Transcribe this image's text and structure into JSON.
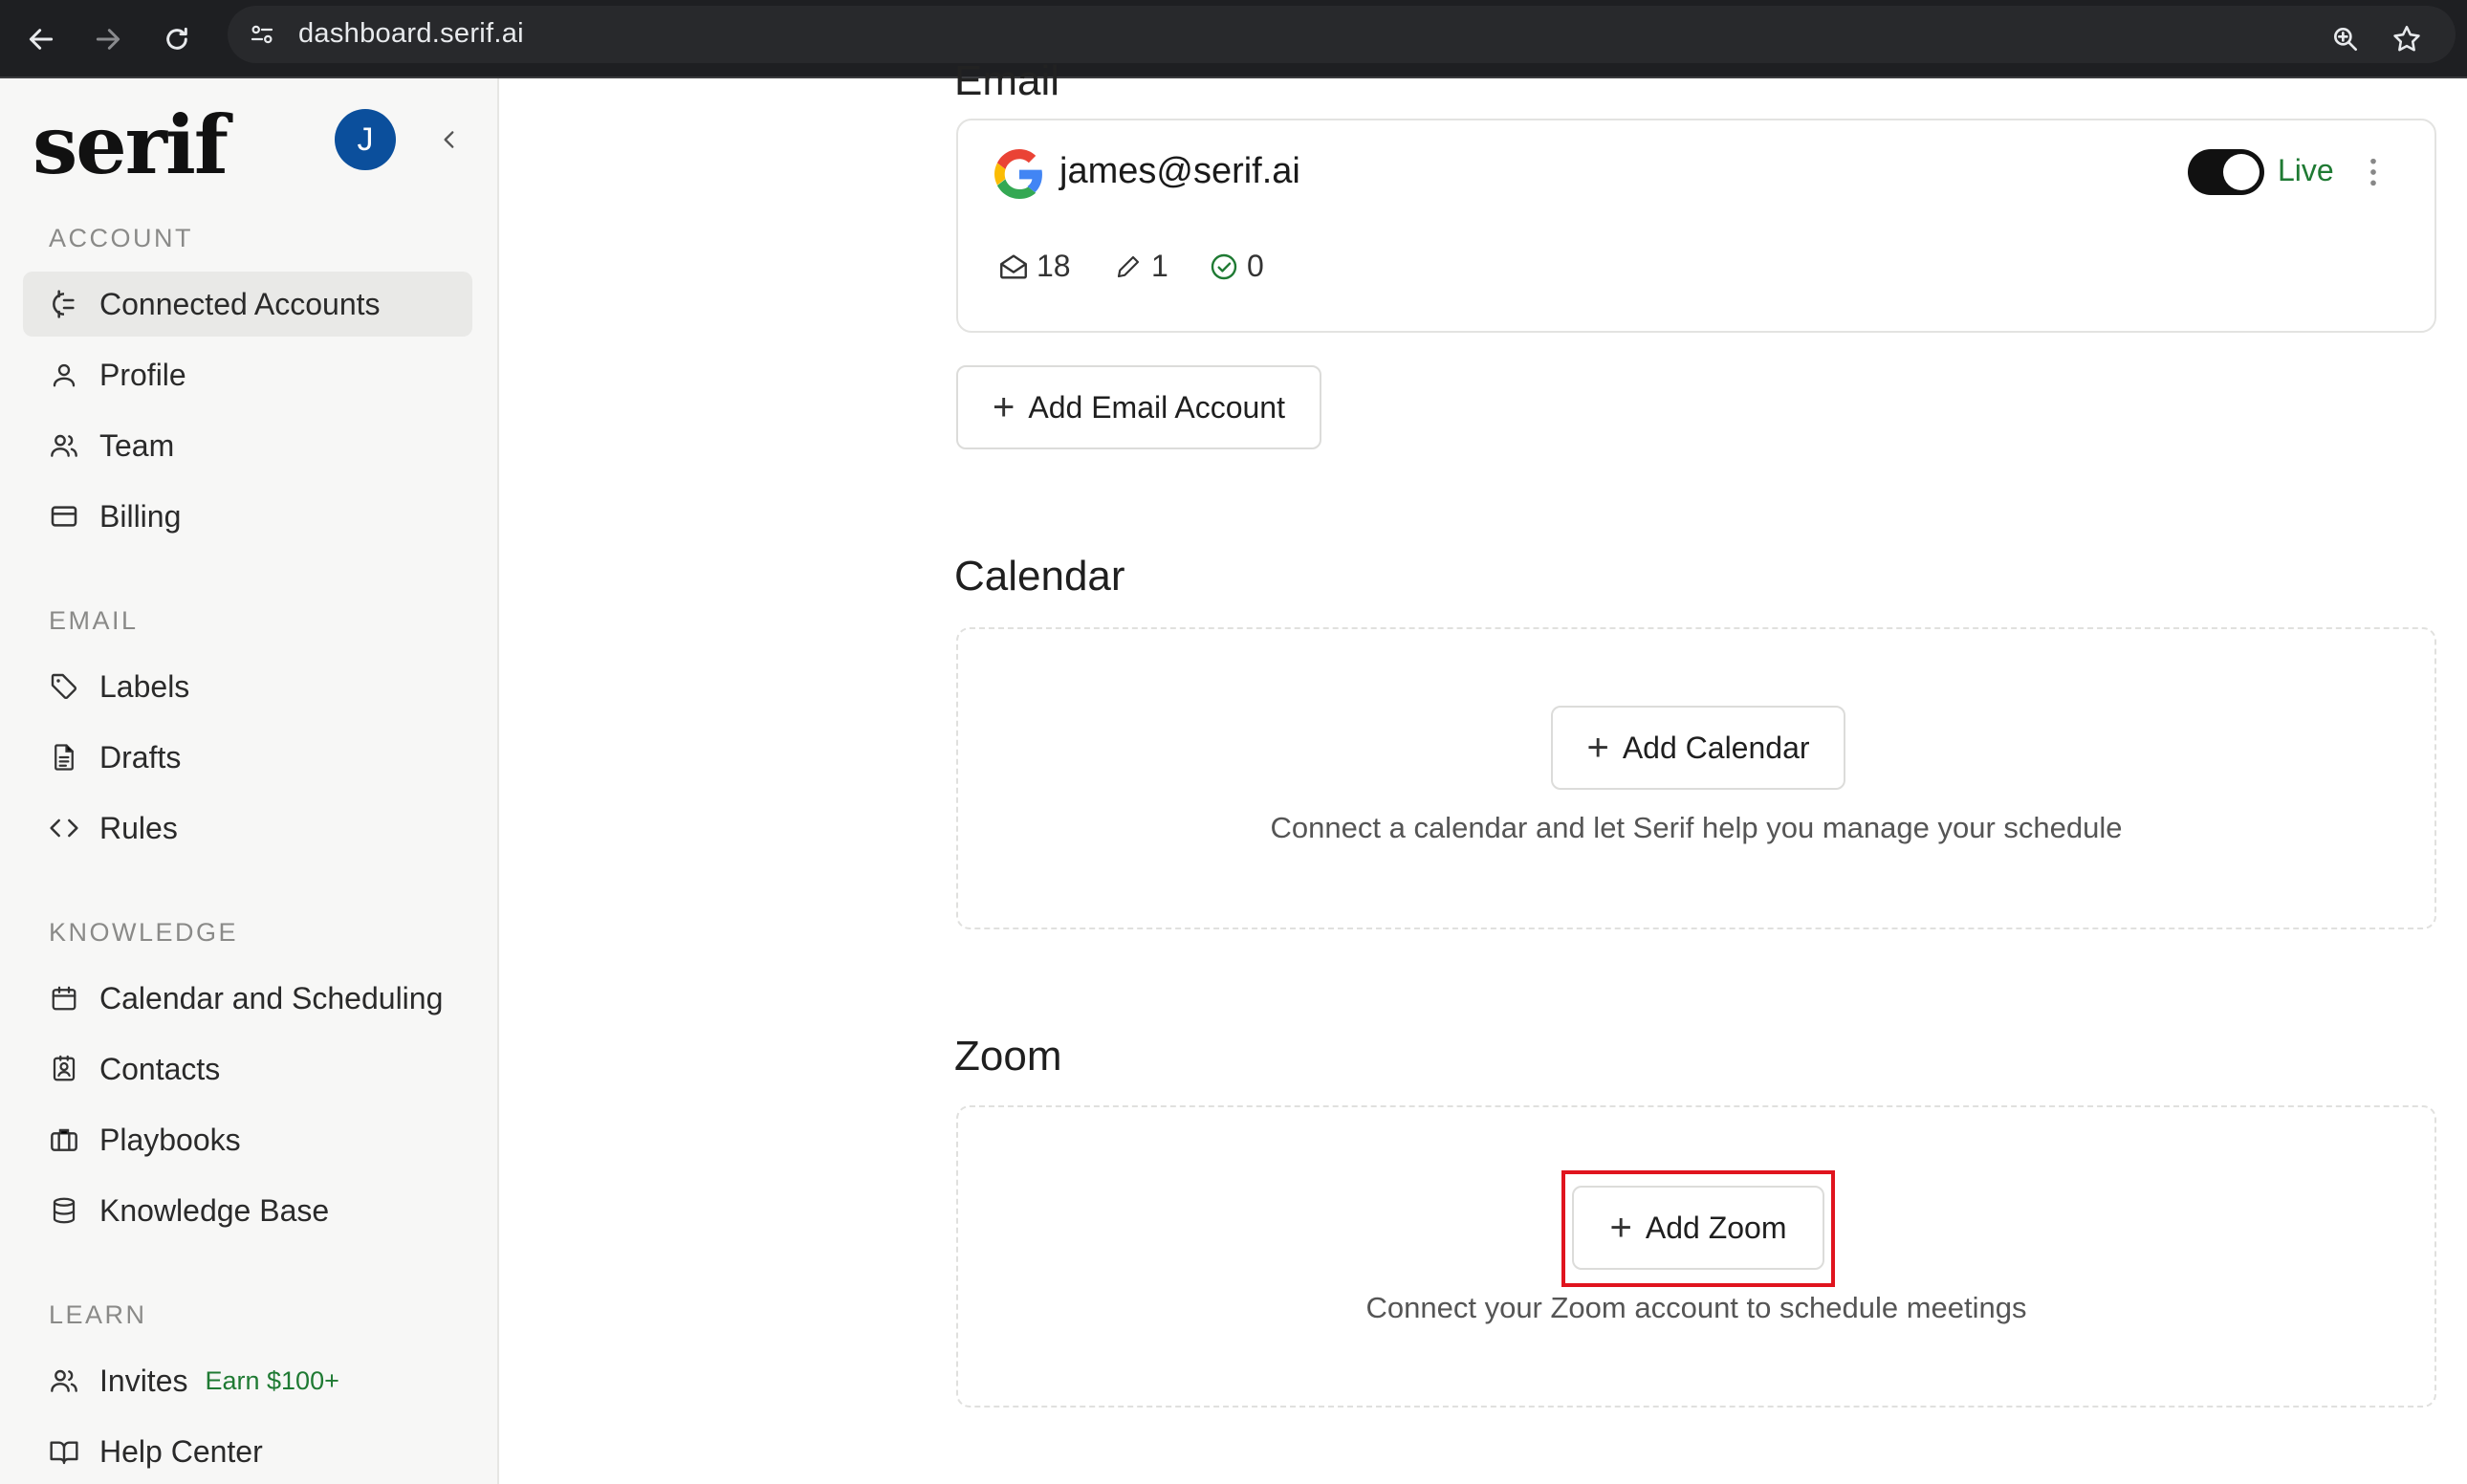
{
  "browser": {
    "url": "dashboard.serif.ai"
  },
  "sidebar": {
    "logo": "serif",
    "avatar_initial": "J",
    "sections": [
      {
        "label": "ACCOUNT"
      },
      {
        "label": "EMAIL"
      },
      {
        "label": "KNOWLEDGE"
      },
      {
        "label": "LEARN"
      }
    ],
    "items": {
      "connected_accounts": "Connected Accounts",
      "profile": "Profile",
      "team": "Team",
      "billing": "Billing",
      "labels": "Labels",
      "drafts": "Drafts",
      "rules": "Rules",
      "calendar_scheduling": "Calendar and Scheduling",
      "contacts": "Contacts",
      "playbooks": "Playbooks",
      "knowledge_base": "Knowledge Base",
      "invites": "Invites",
      "invites_badge": "Earn $100+",
      "help_center": "Help Center"
    }
  },
  "main": {
    "email_heading": "Email",
    "email_account": {
      "address": "james@serif.ai",
      "status": "Live",
      "inbox_count": "18",
      "draft_count": "1",
      "done_count": "0"
    },
    "add_email_label": "Add Email Account",
    "calendar": {
      "title": "Calendar",
      "button": "Add Calendar",
      "hint": "Connect a calendar and let Serif help you manage your schedule"
    },
    "zoom": {
      "title": "Zoom",
      "button": "Add Zoom",
      "hint": "Connect your Zoom account to schedule meetings"
    }
  },
  "colors": {
    "accent_green": "#1f7a33",
    "avatar_blue": "#0b4f9c",
    "highlight_red": "#e0141e"
  }
}
